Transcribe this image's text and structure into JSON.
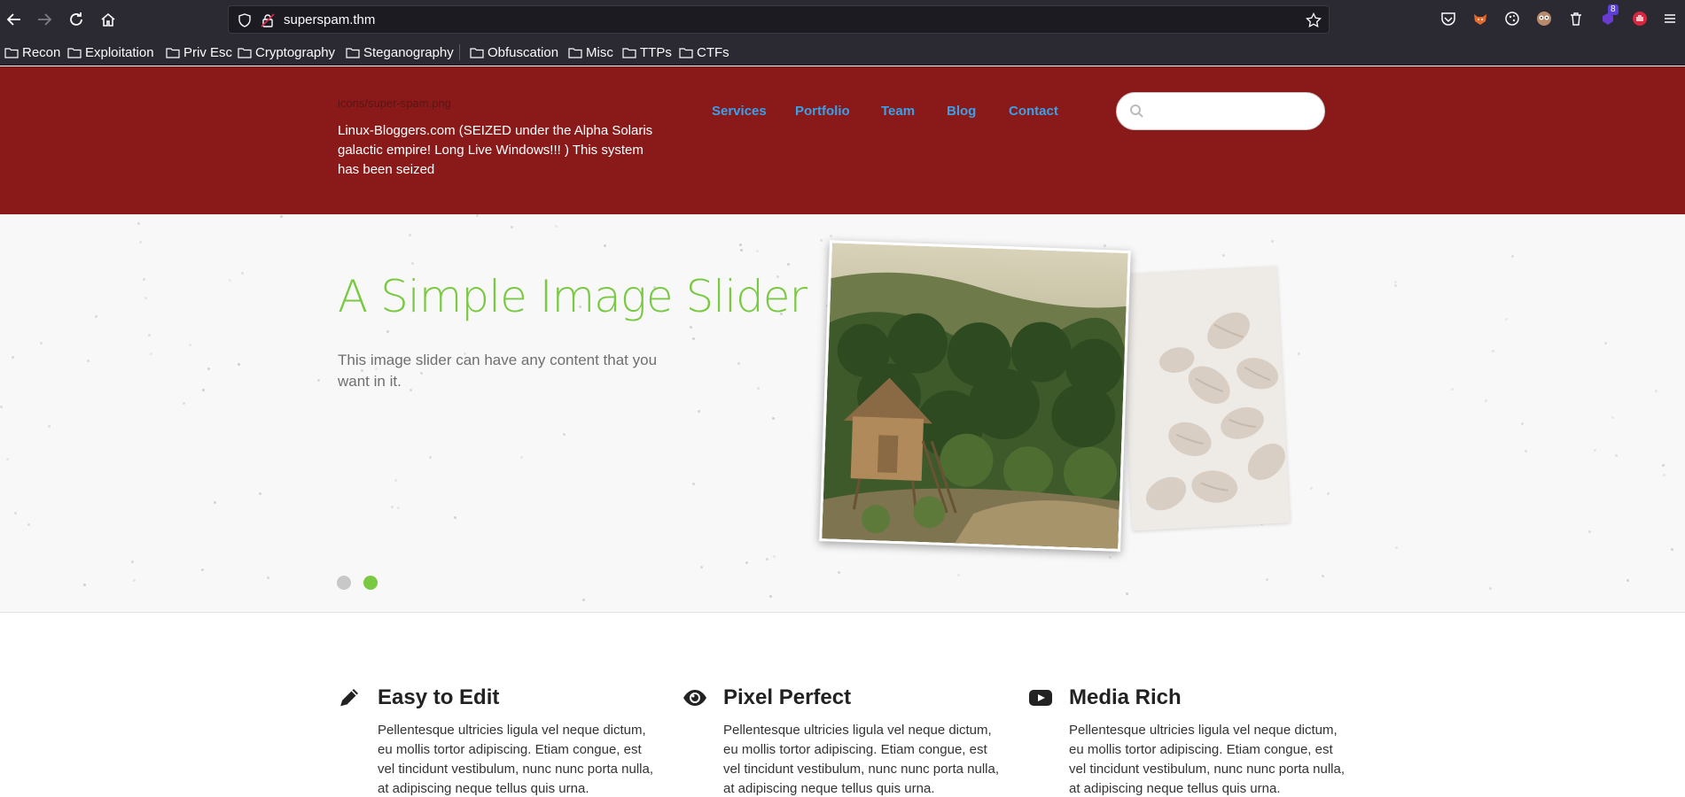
{
  "browser": {
    "url": "superspam.thm",
    "bookmarks": [
      "Recon",
      "Exploitation",
      "Priv Esc",
      "Cryptography",
      "Steganography",
      "Obfuscation",
      "Misc",
      "TTPs",
      "CTFs"
    ],
    "extension_badge": "8"
  },
  "header": {
    "logo_alt": "icons/super-spam.png",
    "tagline": "Linux-Bloggers.com (SEIZED under the Alpha Solaris galactic empire! Long Live Windows!!! ) This system has been seized",
    "nav": [
      "Services",
      "Portfolio",
      "Team",
      "Blog",
      "Contact"
    ],
    "search_placeholder": ""
  },
  "hero": {
    "title": "A Simple Image Slider",
    "text": "This image slider can have any content that you want in it.",
    "active_slide": 2,
    "slide_count": 2
  },
  "features": [
    {
      "icon": "pencil-icon",
      "title": "Easy to Edit",
      "text": "Pellentesque ultricies ligula vel neque dictum, eu mollis tortor adipiscing. Etiam congue, est vel tincidunt vestibulum, nunc nunc porta nulla, at adipiscing neque tellus quis urna."
    },
    {
      "icon": "eye-icon",
      "title": "Pixel Perfect",
      "text": "Pellentesque ultricies ligula vel neque dictum, eu mollis tortor adipiscing. Etiam congue, est vel tincidunt vestibulum, nunc nunc porta nulla, at adipiscing neque tellus quis urna."
    },
    {
      "icon": "youtube-icon",
      "title": "Media Rich",
      "text": "Pellentesque ultricies ligula vel neque dictum, eu mollis tortor adipiscing. Etiam congue, est vel tincidunt vestibulum, nunc nunc porta nulla, at adipiscing neque tellus quis urna."
    }
  ],
  "colors": {
    "header_bg": "#8a1a1a",
    "nav_link": "#3aa0e8",
    "accent_green": "#7ac943",
    "chrome_bg": "#2b2a33"
  }
}
